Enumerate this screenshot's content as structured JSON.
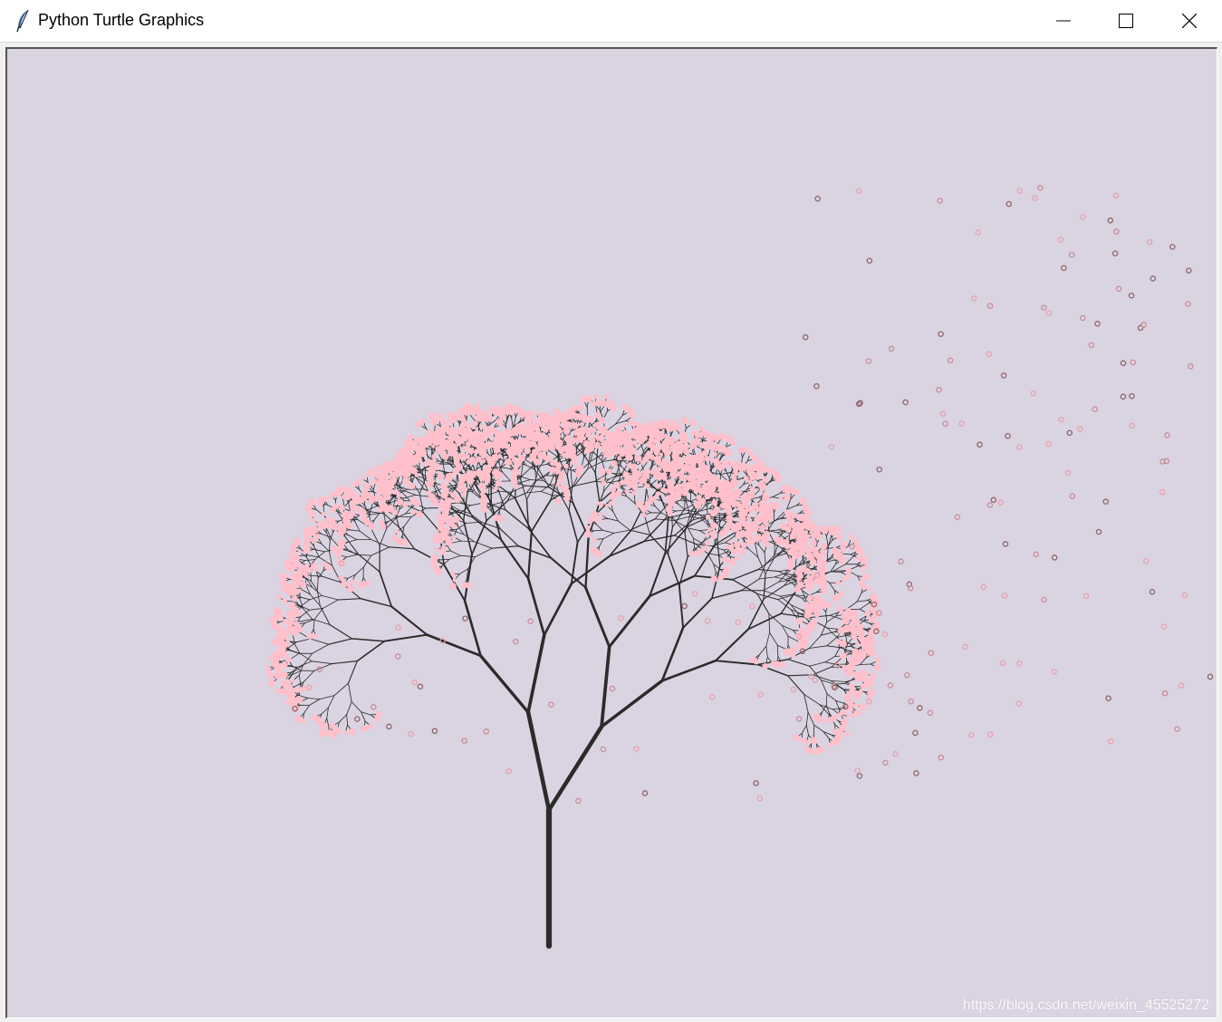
{
  "window": {
    "title": "Python Turtle Graphics",
    "icon": "feather-icon",
    "controls": [
      "minimize-icon",
      "maximize-icon",
      "close-icon"
    ]
  },
  "canvas": {
    "background": "#dad3e2",
    "branch_color": "#2b2b2b",
    "blossom_color": "#ffc0cb",
    "petal_outline_colors": [
      "#e8a2ad",
      "#c98c94",
      "#8f6467"
    ],
    "watermark": "https://blog.csdn.net/weixin_45525272"
  }
}
